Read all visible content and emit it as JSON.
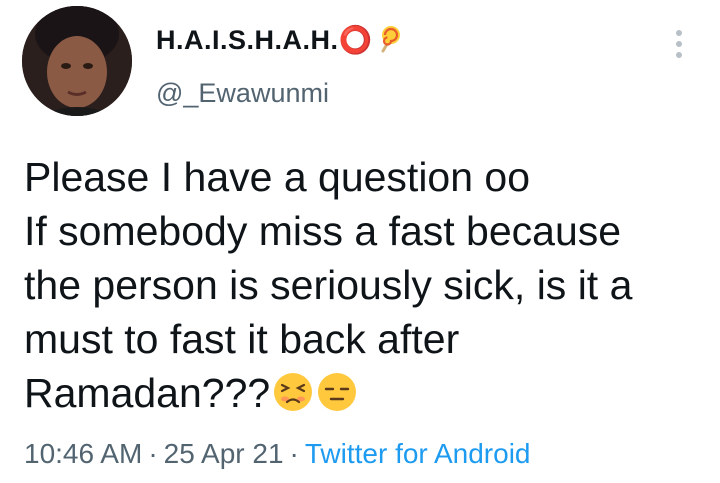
{
  "user": {
    "display_name": "H.A.I.S.H.A.H.⭕",
    "handle": "@_Ewawunmi",
    "avatar": "profile-photo",
    "badge_icon": "lollipop-icon"
  },
  "menu_icon": "more-vertical-icon",
  "tweet": {
    "lines": [
      "Please I have a question oo",
      "If somebody miss a fast because",
      "the person is seriously sick, is it a",
      "must to fast it back after",
      "Ramadan???"
    ],
    "emojis": [
      "persevering-face-emoji",
      "expressionless-face-emoji"
    ]
  },
  "meta": {
    "time": "10:46 AM",
    "separator": "·",
    "date": "25 Apr 21",
    "source": "Twitter for Android"
  },
  "colors": {
    "text": "#0f1419",
    "secondary": "#536471",
    "link": "#1d9bf0"
  }
}
